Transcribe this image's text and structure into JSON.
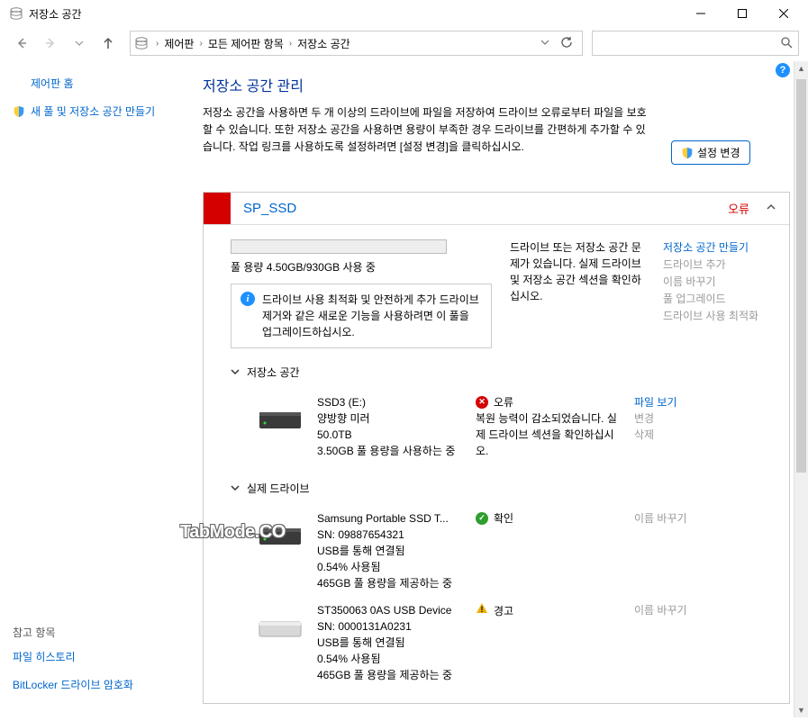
{
  "window": {
    "title": "저장소 공간"
  },
  "breadcrumb": {
    "items": [
      "제어판",
      "모든 제어판 항목",
      "저장소 공간"
    ]
  },
  "sidebar": {
    "home": "제어판 홈",
    "create_pool": "새 풀 및 저장소 공간 만들기",
    "see_also_title": "참고 항목",
    "see_also": [
      "파일 히스토리",
      "BitLocker 드라이브 암호화"
    ]
  },
  "content": {
    "title": "저장소 공간 관리",
    "description": "저장소 공간을 사용하면 두 개 이상의 드라이브에 파일을 저장하여 드라이브 오류로부터 파일을 보호할 수 있습니다. 또한 저장소 공간을 사용하면 용량이 부족한 경우 드라이브를 간편하게 추가할 수 있습니다. 작업 링크를 사용하도록 설정하려면 [설정 변경]을 클릭하십시오.",
    "change_settings": "설정 변경"
  },
  "pool": {
    "name": "SP_SSD",
    "error_label": "오류",
    "capacity": "풀 용량 4.50GB/930GB 사용 중",
    "problem_text": "드라이브 또는 저장소 공간 문제가 있습니다. 실제 드라이브 및 저장소 공간 섹션을 확인하십시오.",
    "actions": {
      "create_space": "저장소 공간 만들기",
      "add_drive": "드라이브 추가",
      "rename": "이름 바꾸기",
      "upgrade": "풀 업그레이드",
      "optimize": "드라이브 사용 최적화"
    },
    "info_msg": "드라이브 사용 최적화 및 안전하게 추가 드라이브 제거와 같은 새로운 기능을 사용하려면 이 풀을 업그레이드하십시오."
  },
  "sections": {
    "spaces": "저장소 공간",
    "drives": "실제 드라이브"
  },
  "space": {
    "name": "SSD3 (E:)",
    "type": "양방향 미러",
    "size": "50.0TB",
    "usage": "3.50GB 풀 용량을 사용하는 중",
    "status_label": "오류",
    "status_detail": "복원 능력이 감소되었습니다. 실제 드라이브 섹션을 확인하십시오.",
    "actions": {
      "view": "파일 보기",
      "change": "변경",
      "delete": "삭제"
    }
  },
  "drives": [
    {
      "name": "Samsung Portable SSD T...",
      "sn": "SN: 09887654321",
      "conn": "USB를 통해 연결됨",
      "used": "0.54% 사용됨",
      "cap": "465GB 풀 용량을 제공하는 중",
      "status": "확인",
      "status_type": "ok",
      "action": "이름 바꾸기"
    },
    {
      "name": "ST350063 0AS USB Device",
      "sn": "SN: 0000131A0231",
      "conn": "USB를 통해 연결됨",
      "used": "0.54% 사용됨",
      "cap": "465GB 풀 용량을 제공하는 중",
      "status": "경고",
      "status_type": "warn",
      "action": "이름 바꾸기"
    }
  ],
  "watermark": "TabMode.CO"
}
